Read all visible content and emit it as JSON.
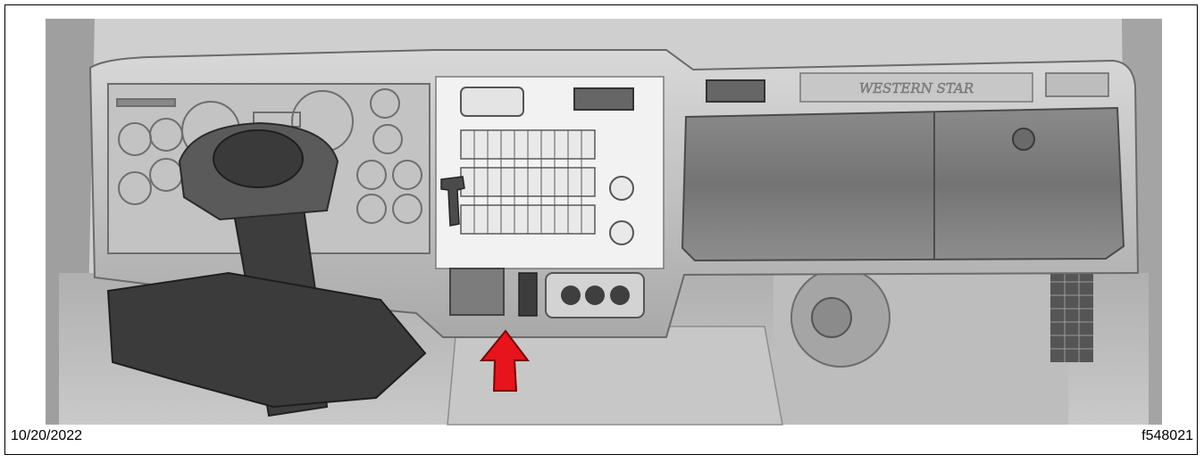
{
  "figure": {
    "date": "10/20/2022",
    "figure_id": "f548021",
    "brand_lettering": "WESTERN STAR"
  },
  "colors": {
    "background": "#ffffff",
    "rendering_gray": "#b9b9b9",
    "highlight_panel": "#f2f2f2",
    "arrow": "#e8141b"
  },
  "icons": {
    "pointer": "red-arrow-icon"
  }
}
